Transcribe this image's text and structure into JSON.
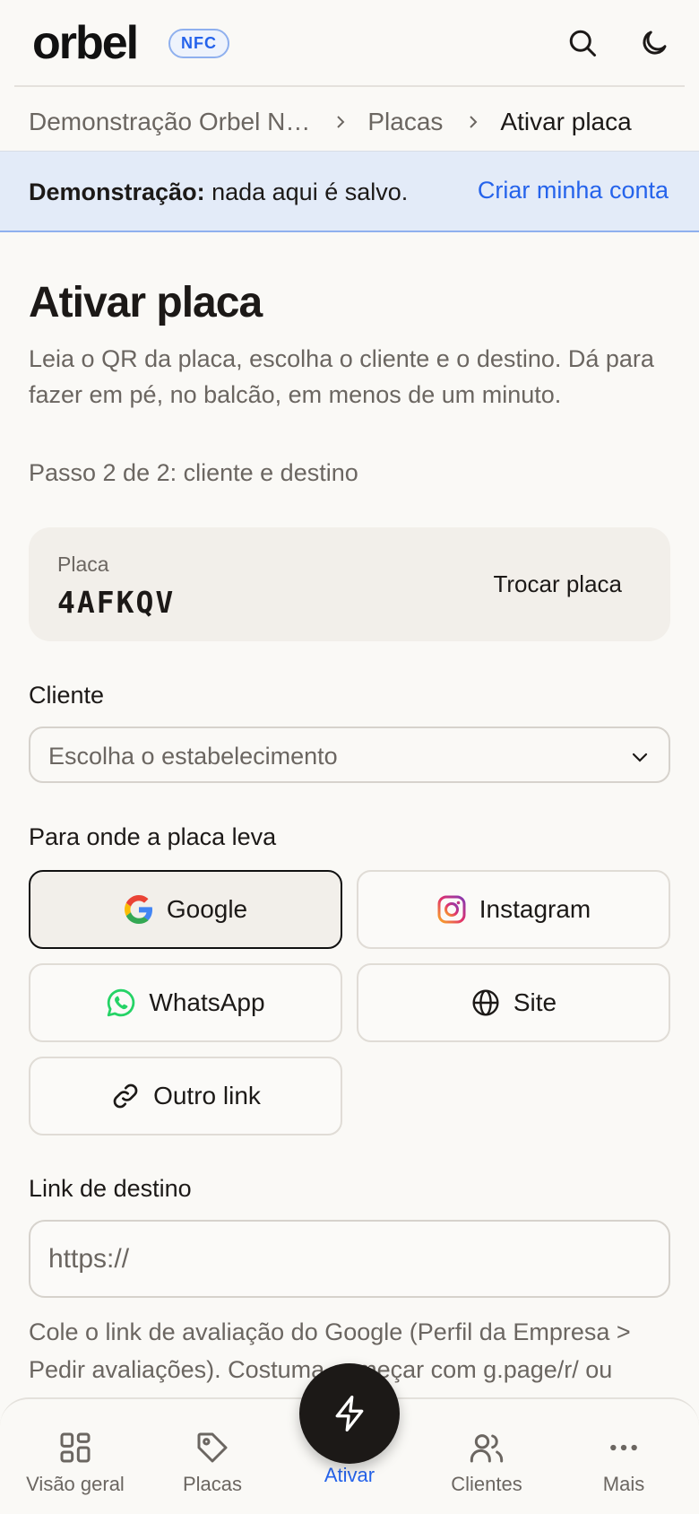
{
  "header": {
    "logo": "orbel",
    "badge": "NFC",
    "icons": [
      "search-icon",
      "moon-icon"
    ]
  },
  "breadcrumb": {
    "items": [
      "Demonstração Orbel N…",
      "Placas",
      "Ativar placa"
    ]
  },
  "banner": {
    "label": "Demonstração:",
    "text": "nada aqui é salvo.",
    "link": "Criar minha conta",
    "accent": "#2563eb"
  },
  "page": {
    "title": "Ativar placa",
    "lead": "Leia o QR da placa, escolha o cliente e o destino. Dá para fazer em pé, no balcão, em menos de um minuto.",
    "step": "Passo 2 de 2: cliente e destino"
  },
  "plate": {
    "label": "Placa",
    "code": "4AFKQV",
    "swap_label": "Trocar placa"
  },
  "client": {
    "label": "Cliente",
    "placeholder": "Escolha o estabelecimento"
  },
  "destination": {
    "label": "Para onde a placa leva",
    "options": [
      {
        "label": "Google",
        "icon": "google-icon",
        "selected": true
      },
      {
        "label": "Instagram",
        "icon": "instagram-icon",
        "selected": false
      },
      {
        "label": "WhatsApp",
        "icon": "whatsapp-icon",
        "selected": false
      },
      {
        "label": "Site",
        "icon": "globe-icon",
        "selected": false
      },
      {
        "label": "Outro link",
        "icon": "link-icon",
        "selected": false
      }
    ]
  },
  "link": {
    "label": "Link de destino",
    "placeholder": "https://",
    "help": "Cole o link de avaliação do Google (Perfil da Empresa > Pedir avaliações). Costuma começar com g.page/r/ ou"
  },
  "bottom_nav": {
    "items": [
      {
        "label": "Visão geral",
        "icon": "grid-icon"
      },
      {
        "label": "Placas",
        "icon": "tag-icon"
      },
      {
        "label": "Ativar",
        "icon": "bolt-icon",
        "active": true
      },
      {
        "label": "Clientes",
        "icon": "users-icon"
      },
      {
        "label": "Mais",
        "icon": "more-icon"
      }
    ]
  }
}
